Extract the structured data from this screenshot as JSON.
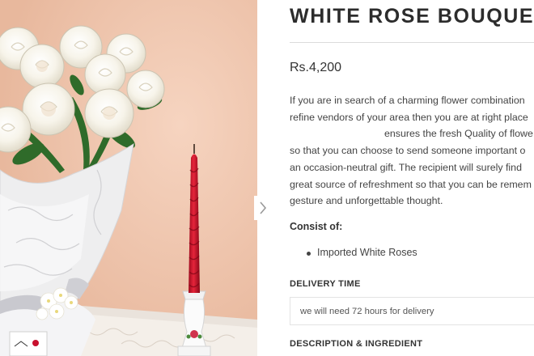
{
  "product": {
    "title": "WHITE ROSE BOUQUET",
    "price": "Rs.4,200",
    "description_lines": [
      "If you are in search of a charming flower combination",
      "refine vendors of your area then you are at right place",
      "ensures the fresh Quality of flowe",
      "so that you can choose to send someone important o",
      "an occasion-neutral gift. The recipient will surely find",
      "great source of refreshment so that you can be remem",
      "gesture and unforgettable thought."
    ],
    "consist_heading": "Consist of:",
    "consist_items": [
      "Imported White Roses"
    ],
    "delivery_time_label": "DELIVERY TIME",
    "delivery_time_value": "we will need 72 hours for delivery",
    "description_ingredient_label": "DESCRIPTION & INGREDIENT"
  },
  "gallery": {
    "image_subject": "white rose bouquet with red candle",
    "next_icon": "chevron-right-icon"
  },
  "colors": {
    "background_wall": "#f0c6ae",
    "candle": "#c8102e",
    "title_text": "#2c2c2c",
    "body_text": "#444444"
  }
}
